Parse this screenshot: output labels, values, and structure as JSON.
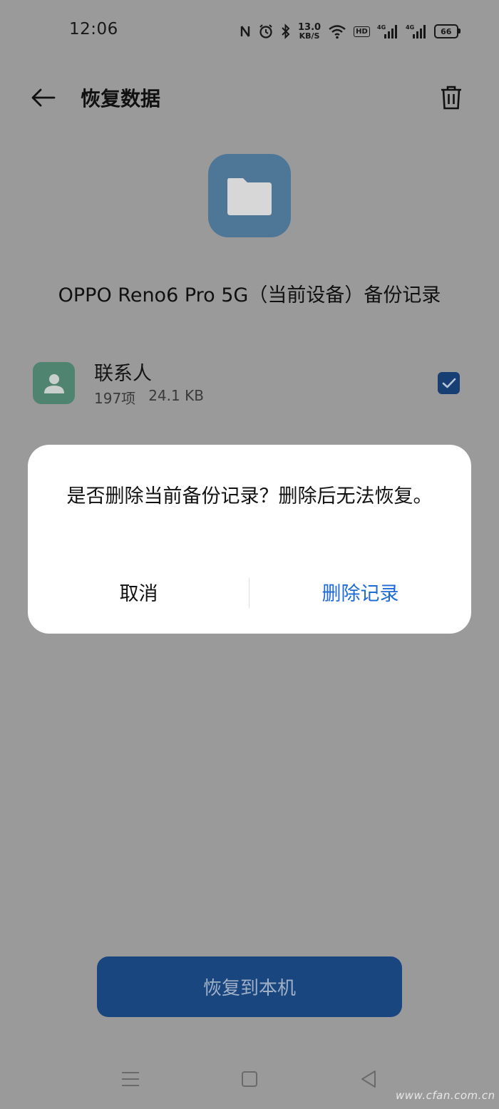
{
  "status_bar": {
    "time": "12:06",
    "net_speed_value": "13.0",
    "net_speed_unit": "KB/S",
    "hd_label": "HD",
    "signal1_label": "4G",
    "signal2_label": "4G",
    "battery_level": "66"
  },
  "header": {
    "title": "恢复数据",
    "back_icon": "arrow-left-icon",
    "delete_icon": "trash-icon"
  },
  "backup": {
    "device_title": "OPPO Reno6 Pro 5G（当前设备）备份记录",
    "folder_icon": "folder-icon"
  },
  "contacts_item": {
    "label": "联系人",
    "count": "197项",
    "size": "24.1 KB",
    "checked": true
  },
  "dialog": {
    "message": "是否删除当前备份记录？删除后无法恢复。",
    "cancel_label": "取消",
    "confirm_label": "删除记录"
  },
  "restore_button_label": "恢复到本机",
  "watermark": "www.cfan.com.cn",
  "colors": {
    "overlay": "#9a9a9a",
    "primary_blue": "#1e6bd6",
    "folder_tile": "#4d7697",
    "contacts_tile": "#4e8470"
  }
}
